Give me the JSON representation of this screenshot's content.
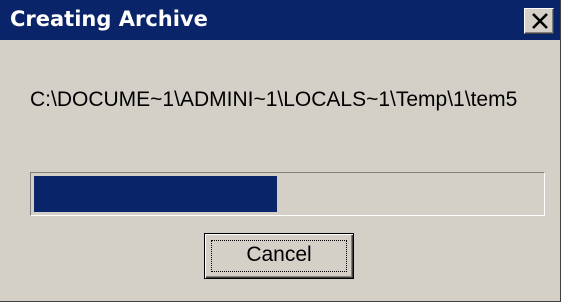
{
  "dialog": {
    "title": "Creating Archive",
    "close_icon": "close-icon",
    "path": "C:\\DOCUME~1\\ADMINI~1\\LOCALS~1\\Temp\\1\\tem5",
    "progress_fraction": 0.48,
    "cancel_label": "Cancel"
  },
  "colors": {
    "titlebar": "#0a246a",
    "progress_fill": "#0a246a",
    "face": "#d4d0c8"
  }
}
